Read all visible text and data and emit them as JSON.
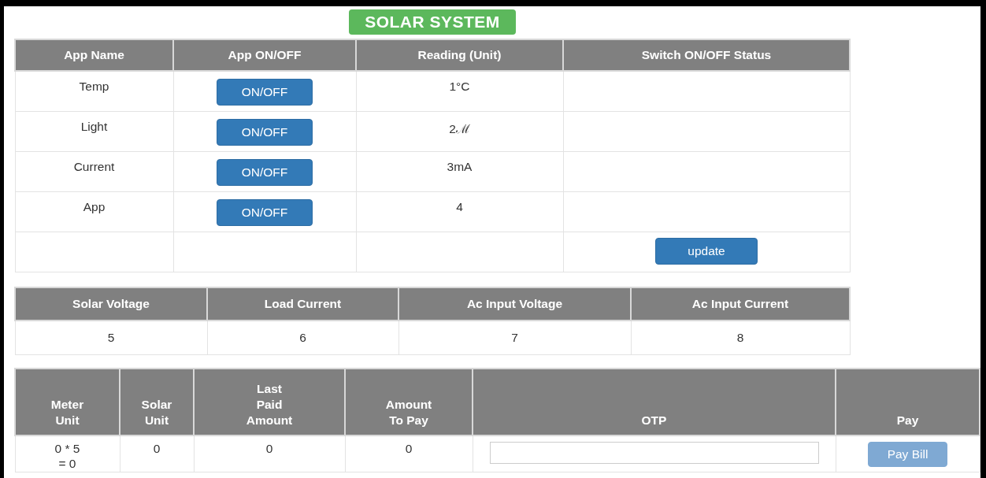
{
  "title": "SOLAR SYSTEM",
  "apps_table": {
    "columns": [
      "App Name",
      "App ON/OFF",
      "Reading (Unit)",
      "Switch ON/OFF Status"
    ],
    "rows": [
      {
        "name": "Temp",
        "button": "ON/OFF",
        "reading": "1°C"
      },
      {
        "name": "Light",
        "button": "ON/OFF",
        "reading": "2ℳ"
      },
      {
        "name": "Current",
        "button": "ON/OFF",
        "reading": "3mA"
      },
      {
        "name": "App",
        "button": "ON/OFF",
        "reading": "4"
      }
    ],
    "update_button": "update"
  },
  "power_table": {
    "columns": [
      "Solar Voltage",
      "Load Current",
      "Ac Input Voltage",
      "Ac Input Current"
    ],
    "values": [
      "5",
      "6",
      "7",
      "8"
    ]
  },
  "bill_table": {
    "columns": [
      [
        "Meter",
        "Unit"
      ],
      [
        "Solar",
        "Unit"
      ],
      [
        "Last",
        "Paid",
        "Amount"
      ],
      [
        "Amount",
        "To Pay"
      ],
      [
        "OTP"
      ],
      [
        "Pay"
      ]
    ],
    "meter_unit": [
      "0 * 5",
      "= 0"
    ],
    "solar_unit": "0",
    "last_paid_amount": "0",
    "amount_to_pay": "0",
    "pay_button": {
      "label": "Pay Bill",
      "disabled": true
    }
  }
}
